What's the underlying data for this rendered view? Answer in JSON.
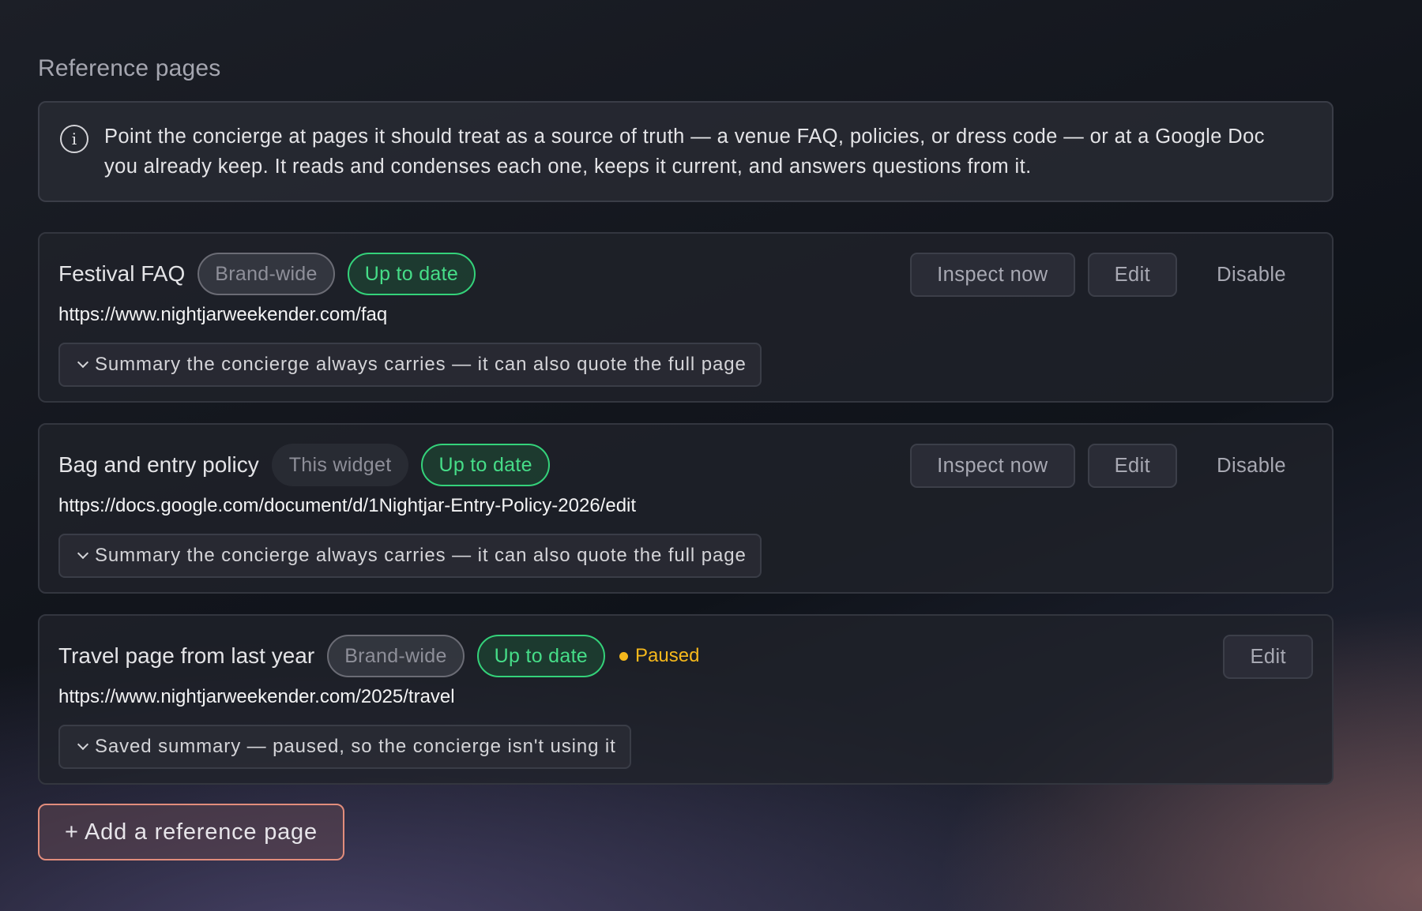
{
  "section": {
    "title": "Reference pages"
  },
  "info": {
    "icon": "info-icon",
    "text": "Point the concierge at pages it should treat as a source of truth — a venue FAQ, policies, or dress code — or at a Google Doc you already keep. It reads and condenses each one, keeps it current, and answers questions from it."
  },
  "cards": [
    {
      "title": "Festival FAQ",
      "scope": "Brand-wide",
      "status": "Up to date",
      "url": "https://www.nightjarweekender.com/faq",
      "summary": "Summary the concierge always carries — it can also quote the full page",
      "actions": {
        "inspect": "Inspect now",
        "edit": "Edit",
        "disable": "Disable"
      }
    },
    {
      "title": "Bag and entry policy",
      "scope": "This widget",
      "status": "Up to date",
      "url": "https://docs.google.com/document/d/1Nightjar-Entry-Policy-2026/edit",
      "summary": "Summary the concierge always carries — it can also quote the full page",
      "actions": {
        "inspect": "Inspect now",
        "edit": "Edit",
        "disable": "Disable"
      }
    },
    {
      "title": "Travel page from last year",
      "scope": "Brand-wide",
      "status": "Up to date",
      "paused": "Paused",
      "url": "https://www.nightjarweekender.com/2025/travel",
      "summary": "Saved summary — paused, so the concierge isn't using it",
      "actions": {
        "edit": "Edit"
      }
    }
  ],
  "add_button": {
    "label": "+ Add a reference page"
  },
  "colors": {
    "status_green": "#46dd88",
    "paused_amber": "#f5b81c",
    "add_border": "#e28d7c"
  }
}
